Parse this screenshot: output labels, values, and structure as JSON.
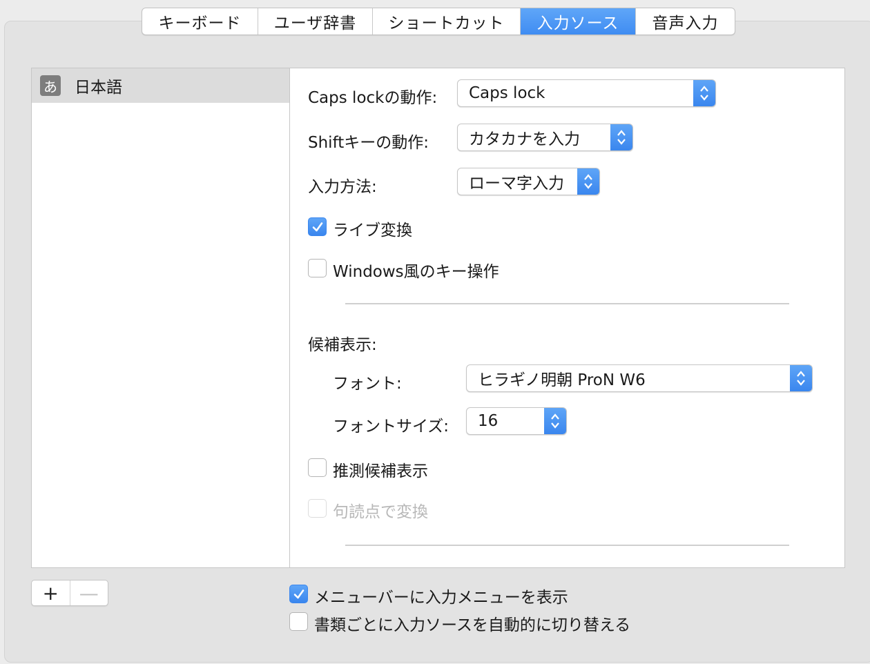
{
  "tabs": [
    "キーボード",
    "ユーザ辞書",
    "ショートカット",
    "入力ソース",
    "音声入力"
  ],
  "active_tab": "入力ソース",
  "source_list": {
    "items": [
      {
        "icon": "あ",
        "label": "日本語"
      }
    ]
  },
  "settings": {
    "caps_lock": {
      "label": "Caps lockの動作:",
      "value": "Caps lock"
    },
    "shift": {
      "label": "Shiftキーの動作:",
      "value": "カタカナを入力"
    },
    "input_method": {
      "label": "入力方法:",
      "value": "ローマ字入力"
    },
    "live_conversion": {
      "label": "ライブ変換",
      "checked": true
    },
    "windows_keys": {
      "label": "Windows風のキー操作",
      "checked": false
    },
    "candidates_heading": "候補表示:",
    "font": {
      "label": "フォント:",
      "value": "ヒラギノ明朝 ProN W6"
    },
    "font_size": {
      "label": "フォントサイズ:",
      "value": "16"
    },
    "predictive": {
      "label": "推測候補表示",
      "checked": false
    },
    "punctuation": {
      "label": "句読点で変換",
      "checked": false,
      "enabled": false
    }
  },
  "bottom": {
    "add_label": "+",
    "remove_label": "—",
    "show_menu": {
      "label": "メニューバーに入力メニューを表示",
      "checked": true
    },
    "auto_switch": {
      "label": "書類ごとに入力ソースを自動的に切り替える",
      "checked": false
    }
  },
  "colors": {
    "accent": "#3f8cf2",
    "selection_gray": "#dcdcdc"
  }
}
